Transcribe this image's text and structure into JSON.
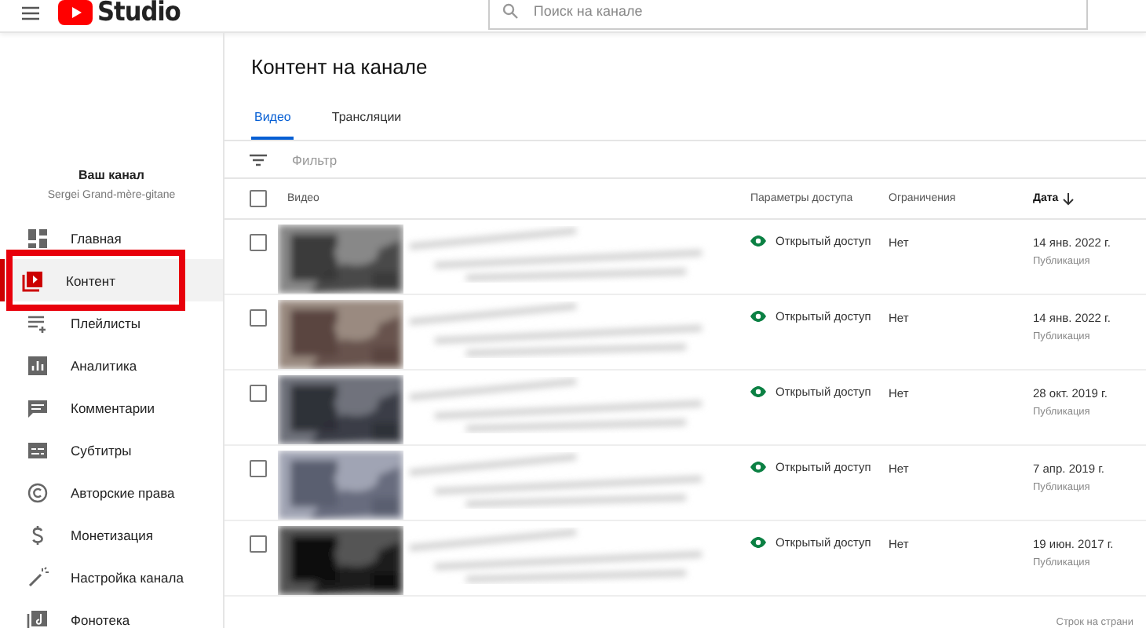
{
  "header": {
    "logo_text": "Studio",
    "search": {
      "placeholder": "Поиск на канале"
    }
  },
  "sidebar": {
    "channel_label": "Ваш канал",
    "channel_name": "Sergei Grand-mère-gitane",
    "items": [
      {
        "label": "Главная",
        "selected": false,
        "highlighted": false
      },
      {
        "label": "Контент",
        "selected": true,
        "highlighted": true
      },
      {
        "label": "Плейлисты",
        "selected": false,
        "highlighted": false
      },
      {
        "label": "Аналитика",
        "selected": false,
        "highlighted": false
      },
      {
        "label": "Комментарии",
        "selected": false,
        "highlighted": false
      },
      {
        "label": "Субтитры",
        "selected": false,
        "highlighted": false
      },
      {
        "label": "Авторские права",
        "selected": false,
        "highlighted": false
      },
      {
        "label": "Монетизация",
        "selected": false,
        "highlighted": false
      },
      {
        "label": "Настройка канала",
        "selected": false,
        "highlighted": false
      },
      {
        "label": "Фонотека",
        "selected": false,
        "highlighted": false
      }
    ]
  },
  "main": {
    "title": "Контент на канале",
    "tabs": [
      {
        "label": "Видео",
        "selected": true
      },
      {
        "label": "Трансляции",
        "selected": false
      }
    ],
    "filter": {
      "placeholder": "Фильтр"
    },
    "table": {
      "select_all_checked": false,
      "columns": [
        {
          "label": "Видео",
          "sorted": false
        },
        {
          "label": "Параметры доступа",
          "sorted": false
        },
        {
          "label": "Ограничения",
          "sorted": false
        },
        {
          "label": "Дата",
          "sorted": true
        }
      ],
      "rows": [
        {
          "checked": false,
          "visibility": "Открытый доступ",
          "restrictions": "Нет",
          "date": "14 янв. 2022 г.",
          "date_note": "Публикация"
        },
        {
          "checked": false,
          "visibility": "Открытый доступ",
          "restrictions": "Нет",
          "date": "14 янв. 2022 г.",
          "date_note": "Публикация"
        },
        {
          "checked": false,
          "visibility": "Открытый доступ",
          "restrictions": "Нет",
          "date": "28 окт. 2019 г.",
          "date_note": "Публикация"
        },
        {
          "checked": false,
          "visibility": "Открытый доступ",
          "restrictions": "Нет",
          "date": "7 апр. 2019 г.",
          "date_note": "Публикация"
        },
        {
          "checked": false,
          "visibility": "Открытый доступ",
          "restrictions": "Нет",
          "date": "19 июн. 2017 г.",
          "date_note": "Публикация"
        }
      ]
    },
    "footer": "Строк на страни"
  }
}
